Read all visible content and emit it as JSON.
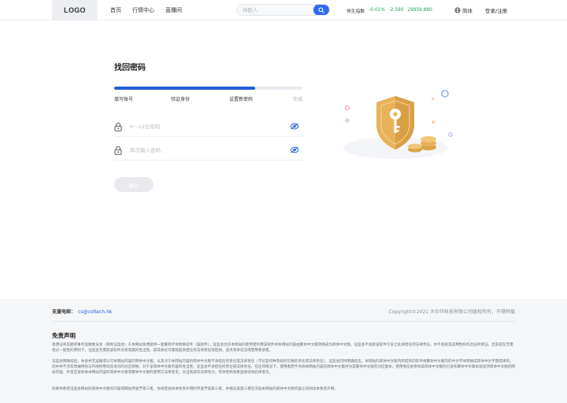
{
  "header": {
    "logo": "LOGO",
    "nav": [
      "首页",
      "行情中心",
      "直播间"
    ],
    "search_placeholder": "持股人",
    "ticker": {
      "name": "恒生指数",
      "change_pct": "-0.01%",
      "change": "-2.590",
      "value": "29959.880"
    },
    "lang": "简体",
    "login": "登录/注册"
  },
  "form": {
    "title": "找回密码",
    "progress": 0.75,
    "steps": [
      {
        "label": "填写账号",
        "state": "done"
      },
      {
        "label": "验证身份",
        "state": "done"
      },
      {
        "label": "设置新密码",
        "state": "current"
      },
      {
        "label": "完成",
        "state": "pending"
      }
    ],
    "password_placeholder": "6～12位密码",
    "confirm_placeholder": "再次输入密码",
    "confirm_button": "确认"
  },
  "colors": {
    "accent": "#1f5fd6",
    "shield": "#e8b25a",
    "up": "#18a058"
  },
  "footer": {
    "support_label": "支援电邮：",
    "support_email": "cs@coltech.hk",
    "copyright": "Copyright©2021 大中华科技有限公司版权所有，不得转载",
    "disclaimer_title": "免责声明",
    "p1": "香港证券及期货事务监察委员会（简称证监会）于本网站免费提供一套繁简字体转换软件（该软件），证监会允许本网站的使用者利用该软件将本网站内容由繁体中文版转换成为简体中文版。证监会不会就该软件欠妥之处承担任何法律责任，亦不会就其适用性和作出任何保证。尤其是在无需经过一般性的原则下，证监会无需就该软件对某境遇的性当性、其或表达可靠程度承担任何法律责任或担保，该点须承说流或使用者承担。",
    "p2": "证监会明确指出，本会并无准确或认可本网站内容的简体中文版。以及对于本网站内容的简体中文版不承担任何责任或法律责任（不论是何种及如何引致的责任或法律责任），证监会同时明确指出，本网站的简体中文版内所提到的软件将繁体中文版内的中文字体转换成简体中文字而得来的，因中并不涉及改编特别与内地所用词及语句的对应转换。对于该简体中文版内容的性当性，证监会不承担任何责任或法律责任。在任何情况下，使用者若不点阅本网站内容的简体中文版并为其繁体中文版的对应版本。使用者应依参阅该简体中文版的已发布繁体中文版本就该项简体中文版的网站内容，并且应该依依本网站内容的简体中文版或繁体中文版的使用方法律意见，亦当就其的法律效力，有效性和效果直接仿效此律意见。",
    "p3": "如果你希望证监会网站的简体中文版的内容或网站传送予第三者，你承诺会将本免责声明的传送予该第三者，并保证该第三者在浏览本网站的简体中文版内容之前阅读本免责声明。"
  }
}
